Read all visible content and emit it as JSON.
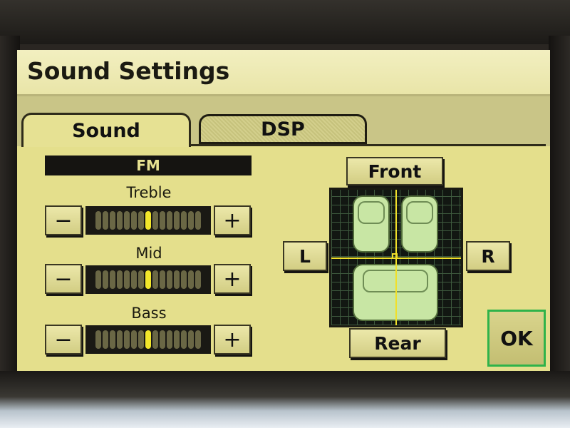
{
  "screen": {
    "title": "Sound Settings"
  },
  "tabs": [
    {
      "label": "Sound",
      "active": true
    },
    {
      "label": "DSP",
      "active": false
    }
  ],
  "source": "FM",
  "controls": {
    "minus_label": "−",
    "plus_label": "+",
    "treble": {
      "label": "Treble",
      "level": 0
    },
    "mid": {
      "label": "Mid",
      "level": 0
    },
    "bass": {
      "label": "Bass",
      "level": 0
    }
  },
  "balance": {
    "front_label": "Front",
    "rear_label": "Rear",
    "left_label": "L",
    "right_label": "R"
  },
  "ok_label": "OK",
  "colors": {
    "screen_bg": "#e4df8c",
    "active_tick": "#f2e62a",
    "ok_border": "#2fb34a"
  }
}
